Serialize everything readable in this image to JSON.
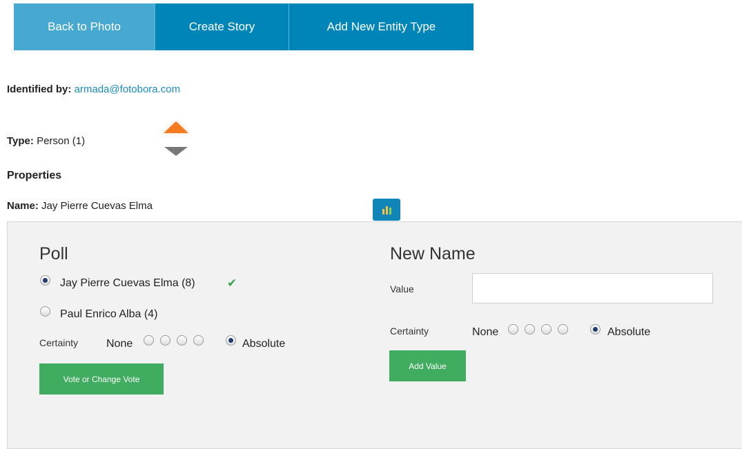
{
  "nav": {
    "tabs": [
      {
        "label": "Back to Photo"
      },
      {
        "label": "Create Story"
      },
      {
        "label": "Add New Entity Type"
      }
    ]
  },
  "info": {
    "identified_label": "Identified by:",
    "identified_value": "armada@fotobora.com",
    "type_label": "Type:",
    "type_value": "Person (1)",
    "properties_heading": "Properties",
    "name_label": "Name:",
    "name_value": "Jay Pierre Cuevas Elma"
  },
  "poll": {
    "heading": "Poll",
    "options": [
      {
        "label": "Jay Pierre Cuevas Elma (8)",
        "selected": true,
        "confirmed_icon": "check-icon"
      },
      {
        "label": "Paul Enrico Alba (4)",
        "selected": false
      }
    ],
    "certainty_label": "Certainty",
    "certainty_min": "None",
    "certainty_max": "Absolute",
    "certainty_level": 5,
    "certainty_steps": 5,
    "vote_button": "Vote or Change Vote"
  },
  "new_name": {
    "heading": "New Name",
    "value_label": "Value",
    "value": "",
    "certainty_label": "Certainty",
    "certainty_min": "None",
    "certainty_max": "Absolute",
    "certainty_level": 5,
    "certainty_steps": 5,
    "add_button": "Add Value"
  },
  "colors": {
    "tab_active": "#47a9d1",
    "tab": "#0085b8",
    "vote_up": "#f47b20",
    "vote_down": "#777777",
    "button_green": "#40ac5f",
    "link": "#1a8cc4",
    "chart_button": "#0f85b8"
  },
  "icons": [
    "arrow-up-icon",
    "arrow-down-icon",
    "bar-chart-icon",
    "check-icon"
  ]
}
